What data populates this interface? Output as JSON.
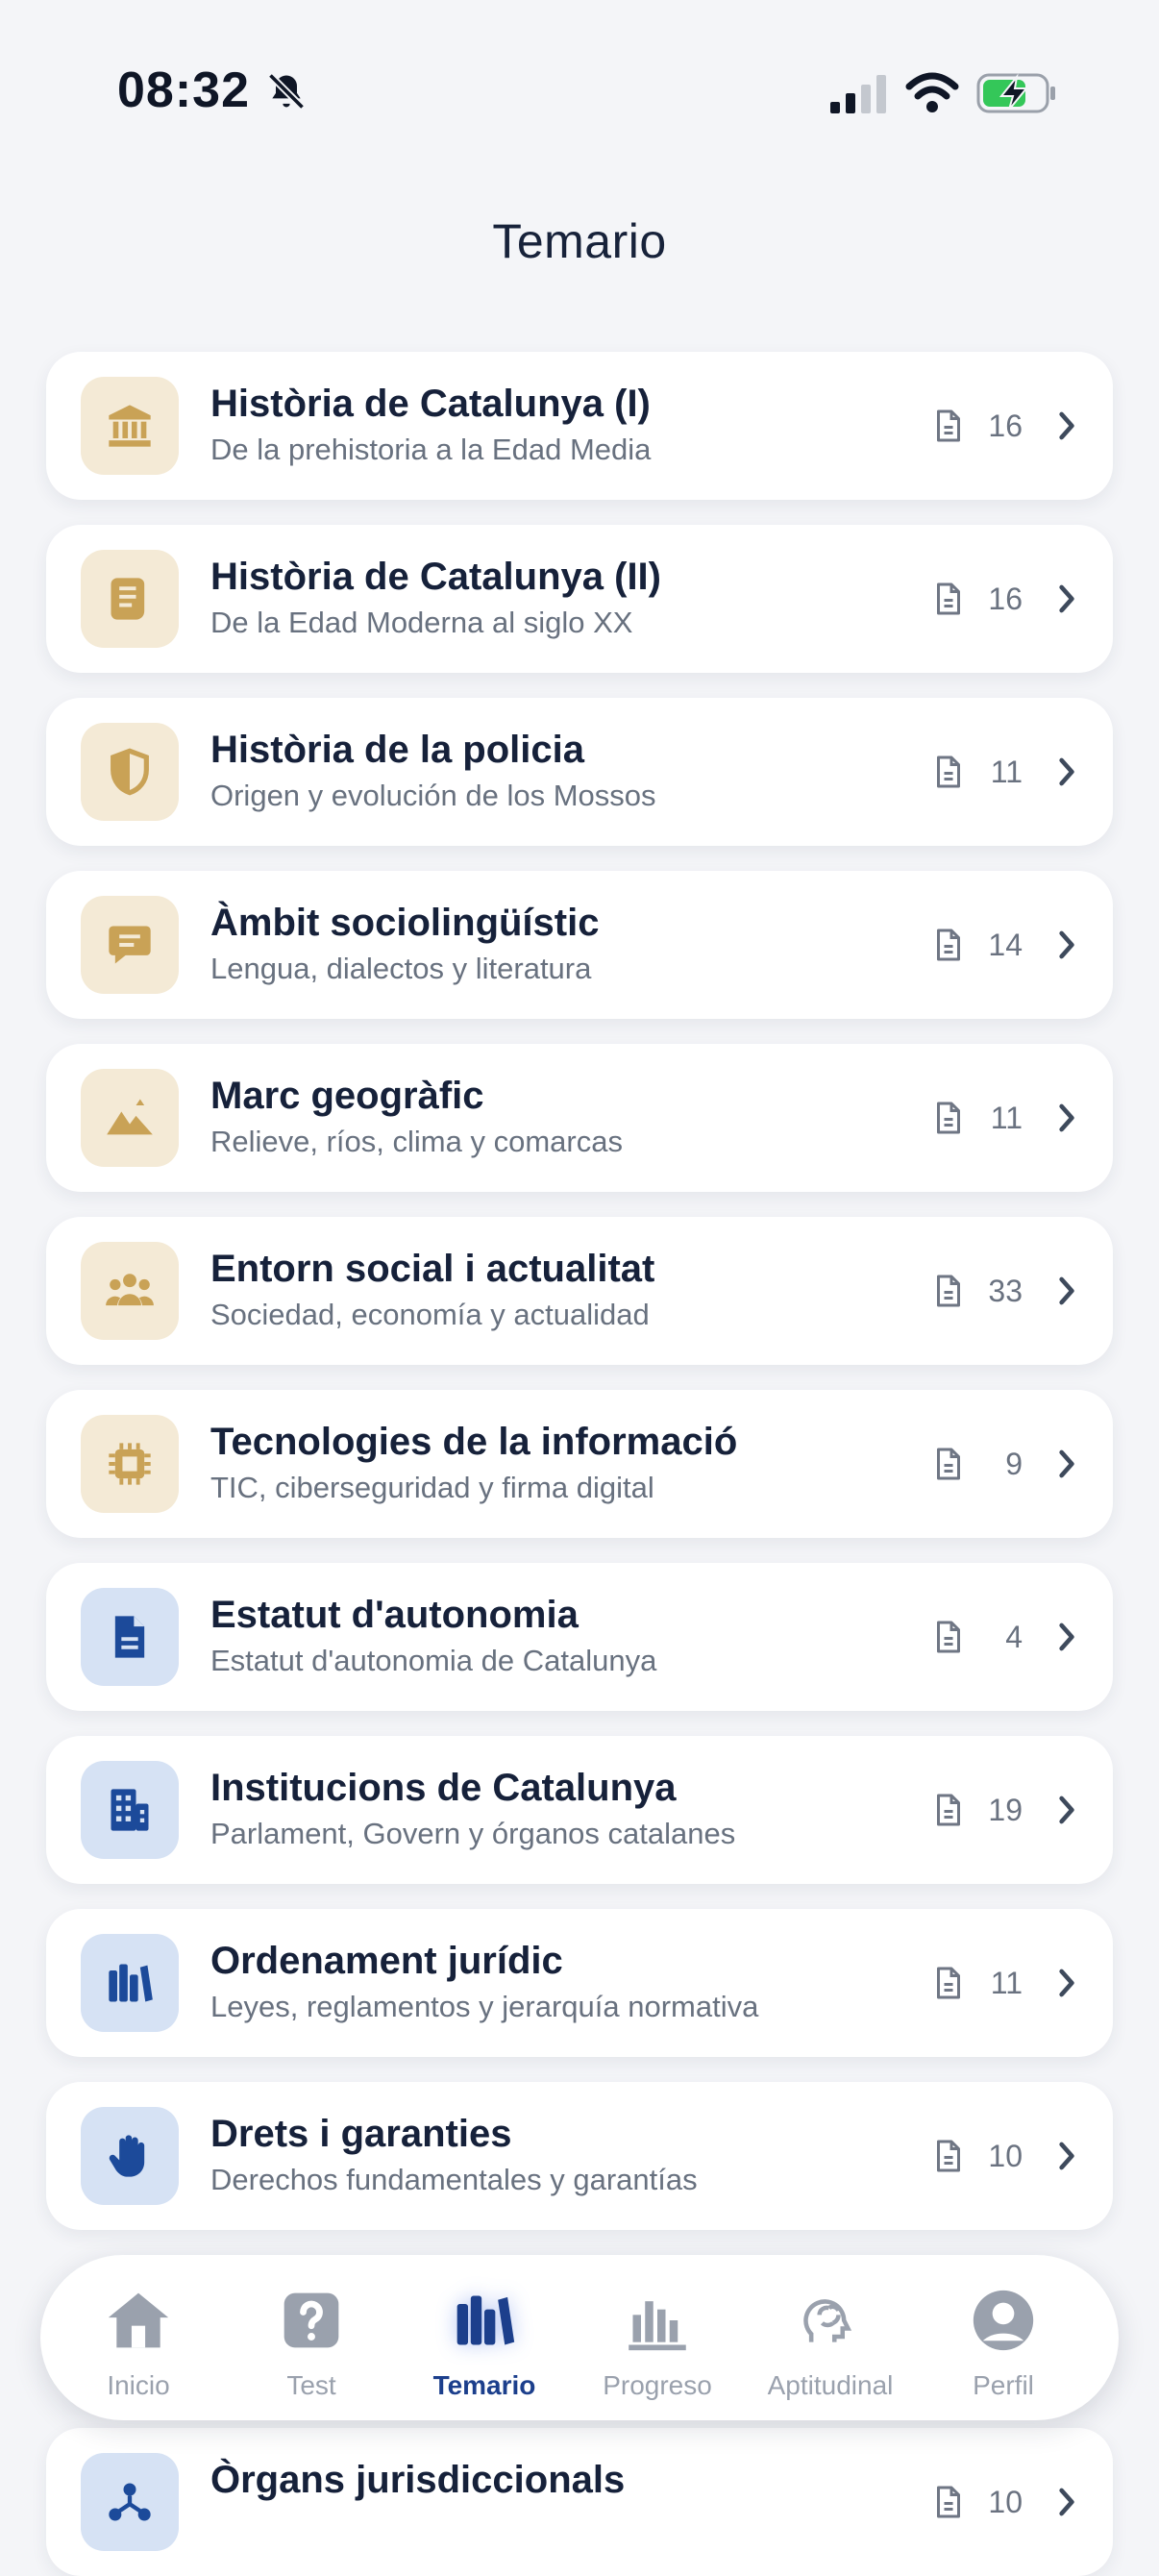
{
  "status_bar": {
    "time": "08:32"
  },
  "header": {
    "title": "Temario"
  },
  "topics": [
    {
      "title": "Història de Catalunya (I)",
      "subtitle": "De la prehistoria a la Edad Media",
      "count": "16",
      "icon": "bank-icon",
      "tone": "gold"
    },
    {
      "title": "Història de Catalunya (II)",
      "subtitle": "De la Edad Moderna al siglo XX",
      "count": "16",
      "icon": "scroll-icon",
      "tone": "gold"
    },
    {
      "title": "Història de la policia",
      "subtitle": "Origen y evolución de los Mossos",
      "count": "11",
      "icon": "shield-icon",
      "tone": "gold"
    },
    {
      "title": "Àmbit sociolingüístic",
      "subtitle": "Lengua, dialectos y literatura",
      "count": "14",
      "icon": "chat-bubble-icon",
      "tone": "gold"
    },
    {
      "title": "Marc geogràfic",
      "subtitle": "Relieve, ríos, clima y comarcas",
      "count": "11",
      "icon": "mountains-icon",
      "tone": "gold"
    },
    {
      "title": "Entorn social i actualitat",
      "subtitle": "Sociedad, economía y actualidad",
      "count": "33",
      "icon": "people-icon",
      "tone": "gold"
    },
    {
      "title": "Tecnologies de la informació",
      "subtitle": "TIC, ciberseguridad y firma digital",
      "count": "9",
      "icon": "chip-icon",
      "tone": "gold"
    },
    {
      "title": "Estatut d'autonomia",
      "subtitle": "Estatut d'autonomia de Catalunya",
      "count": "4",
      "icon": "document-icon",
      "tone": "blue"
    },
    {
      "title": "Institucions de Catalunya",
      "subtitle": "Parlament, Govern y órganos catalanes",
      "count": "19",
      "icon": "building-icon",
      "tone": "blue"
    },
    {
      "title": "Ordenament jurídic",
      "subtitle": "Leyes, reglamentos y jerarquía normativa",
      "count": "11",
      "icon": "books-icon",
      "tone": "blue"
    },
    {
      "title": "Drets i garanties",
      "subtitle": "Derechos fundamentales y garantías",
      "count": "10",
      "icon": "hand-icon",
      "tone": "blue"
    }
  ],
  "peek_topic": {
    "title": "Òrgans jurisdiccionals",
    "count": "10",
    "icon": "network-icon",
    "tone": "blue"
  },
  "tab_bar": {
    "tabs": [
      {
        "label": "Inicio",
        "icon": "home-icon"
      },
      {
        "label": "Test",
        "icon": "question-icon"
      },
      {
        "label": "Temario",
        "icon": "books-icon",
        "active": true
      },
      {
        "label": "Progreso",
        "icon": "bar-chart-icon"
      },
      {
        "label": "Aptitudinal",
        "icon": "brain-icon"
      },
      {
        "label": "Perfil",
        "icon": "user-icon"
      }
    ]
  },
  "colors": {
    "accent_gold": "#c9a256",
    "accent_blue": "#1c4a9a",
    "active_tab": "#1c3f8c"
  }
}
